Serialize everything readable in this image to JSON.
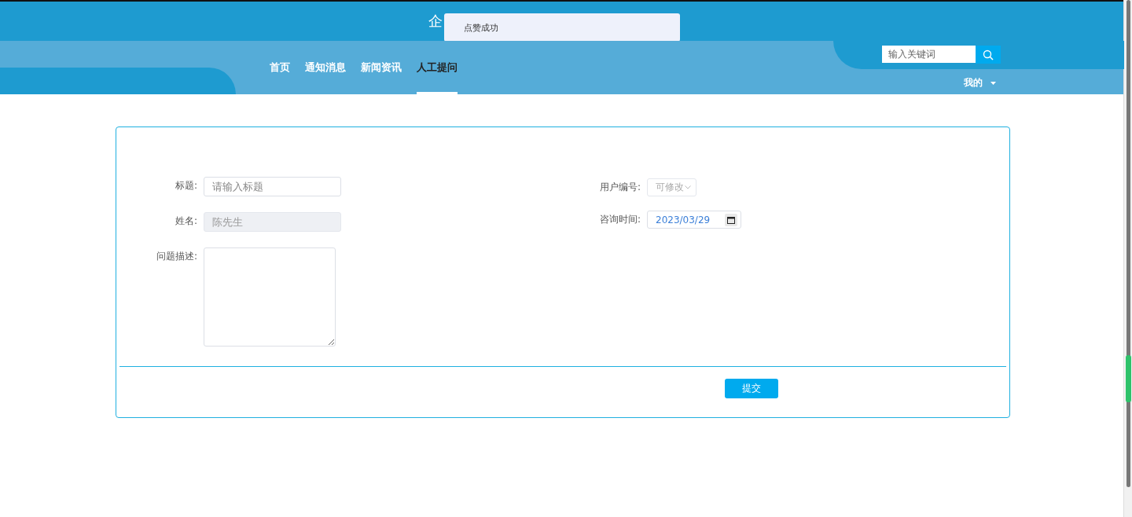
{
  "header": {
    "site_title": "企",
    "toast": "点赞成功",
    "nav": [
      {
        "label": "首页",
        "selected": false
      },
      {
        "label": "通知消息",
        "selected": false
      },
      {
        "label": "新闻资讯",
        "selected": false
      },
      {
        "label": "人工提问",
        "selected": true
      }
    ],
    "search": {
      "placeholder": "输入关键词"
    },
    "user_menu": "我的"
  },
  "form": {
    "left_fields": [
      {
        "kind": "text",
        "label": "标题:",
        "placeholder": "请输入标题",
        "disabled": false
      },
      {
        "kind": "text",
        "label": "姓名:",
        "value": "陈先生",
        "disabled": true
      },
      {
        "kind": "textarea",
        "label": "问题描述:"
      }
    ],
    "right_fields": [
      {
        "kind": "select",
        "label": "用户编号:",
        "value": "可修改",
        "disabled": true
      },
      {
        "kind": "date",
        "label": "咨询时间:",
        "value": "2023/03/29"
      }
    ],
    "submit": "提交"
  }
}
